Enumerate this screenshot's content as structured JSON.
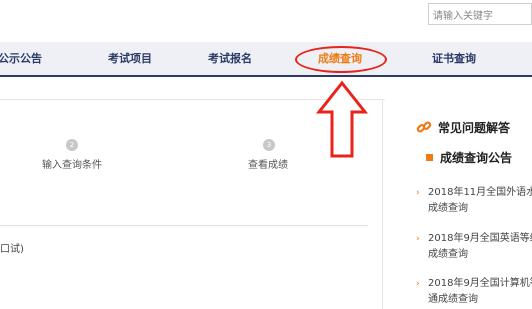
{
  "search": {
    "placeholder": "请输入关键字"
  },
  "nav": {
    "items": [
      {
        "label": "公示公告"
      },
      {
        "label": "考试项目"
      },
      {
        "label": "考试报名"
      },
      {
        "label": "成绩查询"
      },
      {
        "label": "证书查询"
      }
    ],
    "active_color": "#f07a14",
    "text_color": "#2b3a67"
  },
  "steps": [
    {
      "number": "2",
      "label": "输入查询条件"
    },
    {
      "number": "3",
      "label": "查看成绩"
    }
  ],
  "main": {
    "fragment_text": "口试)"
  },
  "sidebar": {
    "faq_title": "常见问题解答",
    "news_title": "成绩查询公告",
    "news_items": [
      {
        "line1": "2018年11月全国外语水",
        "line2": "成绩查询"
      },
      {
        "line1": "2018年9月全国英语等级",
        "line2": "成绩查询"
      },
      {
        "line1": "2018年9月全国计算机等",
        "line2": "通成绩查询"
      }
    ]
  },
  "annotation": {
    "ring_color": "#e8231a",
    "arrow_color": "#e8231a"
  }
}
